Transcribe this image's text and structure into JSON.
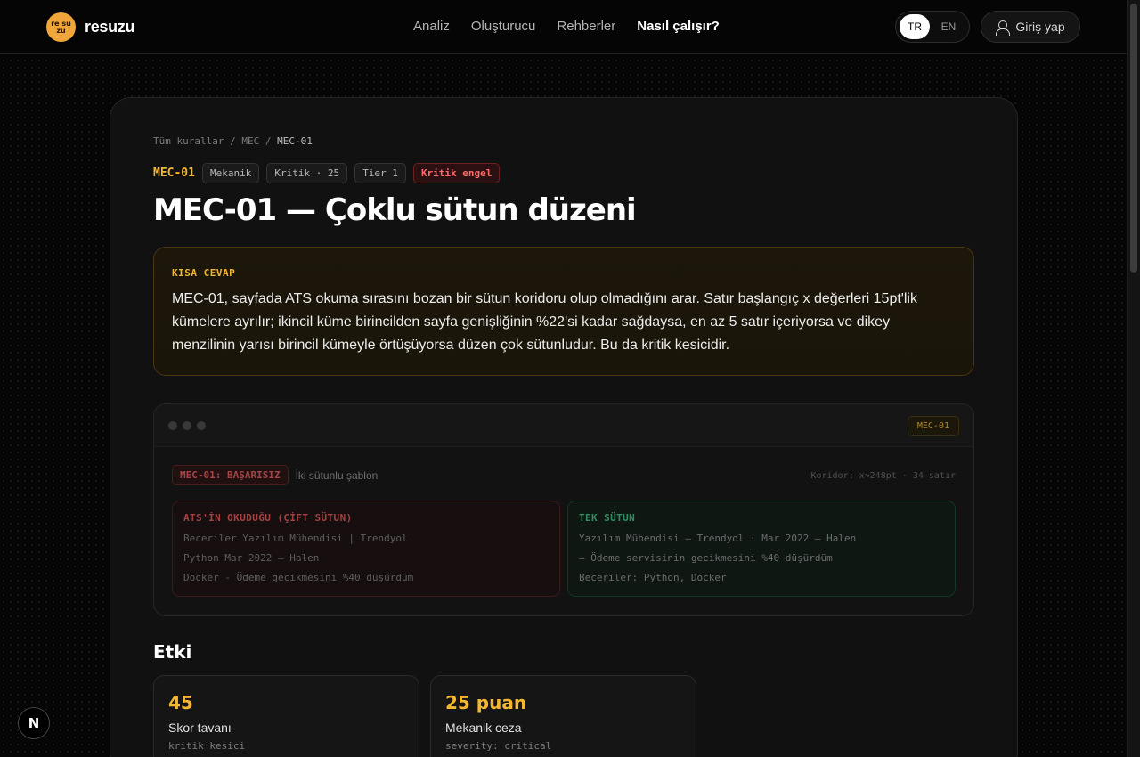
{
  "header": {
    "logo_mark": "re su zu",
    "logo_text": "resuzu",
    "nav": [
      {
        "label": "Analiz"
      },
      {
        "label": "Oluşturucu"
      },
      {
        "label": "Rehberler"
      },
      {
        "label": "Nasıl çalışır?"
      }
    ],
    "lang": {
      "tr": "TR",
      "en": "EN"
    },
    "login_label": "Giriş yap"
  },
  "breadcrumb": {
    "all": "Tüm kurallar",
    "sep": "/",
    "group": "MEC",
    "current": "MEC-01"
  },
  "tags": {
    "id": "MEC-01",
    "category": "Mekanik",
    "severity": "Kritik · 25",
    "tier": "Tier 1",
    "block": "Kritik engel"
  },
  "title": "MEC-01 — Çoklu sütun düzeni",
  "short_answer": {
    "label": "KISA CEVAP",
    "text": "MEC-01, sayfada ATS okuma sırasını bozan bir sütun koridoru olup olmadığını arar. Satır başlangıç x değerleri 15pt'lik kümelere ayrılır; ikincil küme birincilden sayfa genişliğinin %22'si kadar sağdaysa, en az 5 satır içeriyorsa ve dikey menzilinin yarısı birincil kümeyle örtüşüyorsa düzen çok sütunludur. Bu da kritik kesicidir."
  },
  "preview": {
    "badge": "MEC-01",
    "fail_label": "MEC-01: BAŞARISIZ",
    "sub": "İki sütunlu şablon",
    "meta": "Koridor: x≈248pt · 34 satır",
    "bad": {
      "title": "ATS'İN OKUDUĞU (ÇİFT SÜTUN)",
      "lines": [
        "Beceriler Yazılım Mühendisi | Trendyol",
        "Python Mar 2022 – Halen",
        "Docker - Ödeme gecikmesini %40 düşürdüm"
      ]
    },
    "good": {
      "title": "TEK SÜTUN",
      "lines": [
        "Yazılım Mühendisi — Trendyol · Mar 2022 – Halen",
        "– Ödeme servisinin gecikmesini %40 düşürdüm",
        "Beceriler: Python, Docker"
      ]
    }
  },
  "impact": {
    "heading": "Etki",
    "cards": [
      {
        "num": "45",
        "label": "Skor tavanı",
        "sub": "kritik kesici"
      },
      {
        "num": "25 puan",
        "label": "Mekanik ceza",
        "sub": "severity: critical"
      }
    ]
  },
  "dev_badge": "N"
}
